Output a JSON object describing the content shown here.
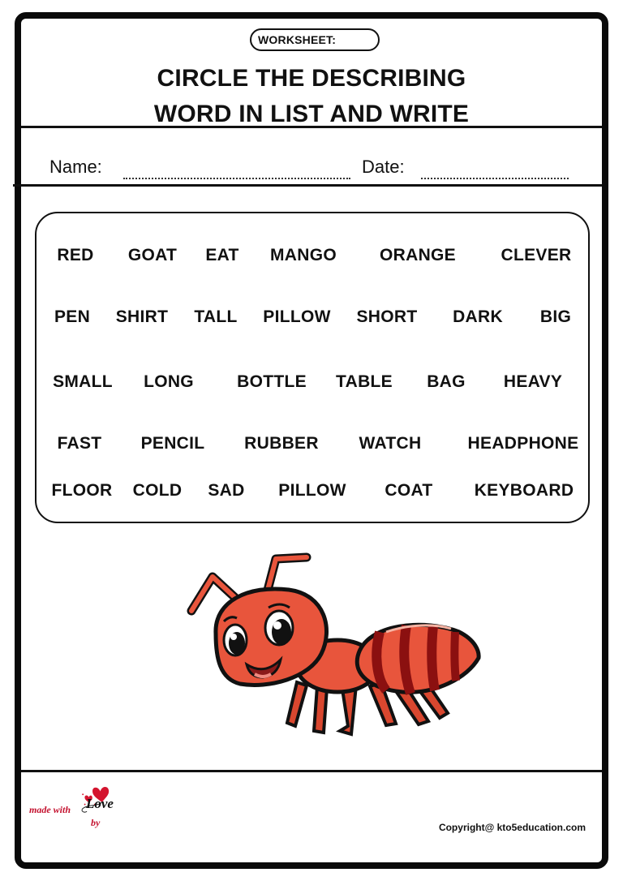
{
  "header": {
    "badge": "WORKSHEET:",
    "title_line1": "CIRCLE THE DESCRIBING",
    "title_line2": "WORD IN LIST AND WRITE"
  },
  "fields": {
    "name_label": "Name:",
    "date_label": "Date:"
  },
  "word_list": {
    "rows": [
      [
        "RED",
        "GOAT",
        "EAT",
        "MANGO",
        "ORANGE",
        "CLEVER"
      ],
      [
        "PEN",
        "SHIRT",
        "TALL",
        "PILLOW",
        "SHORT",
        "DARK",
        "BIG"
      ],
      [
        "SMALL",
        "LONG",
        "BOTTLE",
        "TABLE",
        "BAG",
        "HEAVY"
      ],
      [
        "FAST",
        "PENCIL",
        "RUBBER",
        "WATCH",
        "HEADPHONE"
      ],
      [
        "FLOOR",
        "COLD",
        "SAD",
        "PILLOW",
        "COAT",
        "KEYBOARD"
      ]
    ]
  },
  "illustration": {
    "subject": "cartoon-ant",
    "body_color": "#e8553c",
    "stripe_color": "#8b1010",
    "outline_color": "#111111"
  },
  "footer": {
    "made_with": "made with",
    "love": "Love",
    "by": "by",
    "heart_color": "#d4142e",
    "copyright": "Copyright@ kto5education.com"
  }
}
